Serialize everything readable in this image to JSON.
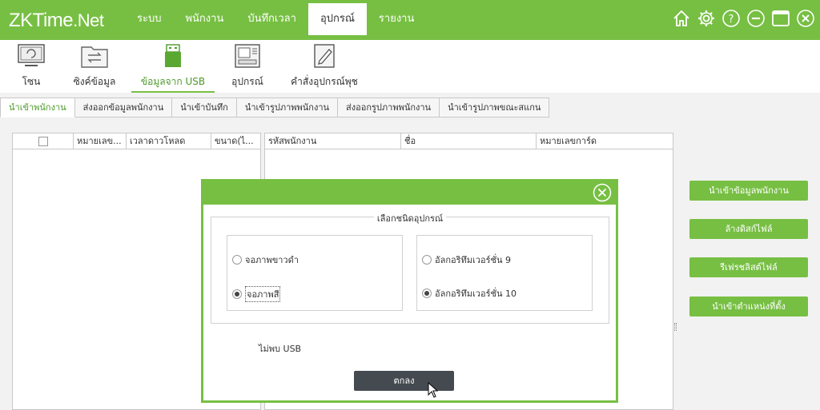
{
  "app": {
    "logo_main": "ZKTime",
    "logo_suffix": ".Net"
  },
  "menu": {
    "items": [
      {
        "label": "ระบบ"
      },
      {
        "label": "พนักงาน"
      },
      {
        "label": "บันทึกเวลา"
      },
      {
        "label": "อุปกรณ์",
        "active": true
      },
      {
        "label": "รายงาน"
      }
    ]
  },
  "window_icons": [
    "home-icon",
    "gear-icon",
    "help-icon",
    "minimize-icon",
    "maximize-icon",
    "close-icon"
  ],
  "toolbar": {
    "items": [
      {
        "label": "โซน",
        "icon": "zone-icon"
      },
      {
        "label": "ซิงค์ข้อมูล",
        "icon": "sync-folder-icon"
      },
      {
        "label": "ข้อมูลจาก USB",
        "icon": "usb-drive-icon",
        "active": true
      },
      {
        "label": "อุปกรณ์",
        "icon": "device-icon"
      },
      {
        "label": "คำสั่งอุปกรณ์พุช",
        "icon": "push-command-icon"
      }
    ]
  },
  "subtabs": [
    {
      "label": "นำเข้าพนักงาน",
      "active": true
    },
    {
      "label": "ส่งออกข้อมูลพนักงาน"
    },
    {
      "label": "นำเข้าบันทึก"
    },
    {
      "label": "นำเข้ารูปภาพพนักงาน"
    },
    {
      "label": "ส่งออกรูปภาพพนักงาน"
    },
    {
      "label": "นำเข้ารูปภาพขณะสแกน"
    }
  ],
  "left_table": {
    "columns": [
      "หมายเลข...",
      "เวลาดาวโหลด",
      "ขนาด(ไ..."
    ]
  },
  "mid_table": {
    "columns": [
      "รหัสพนักงาน",
      "ชื่อ",
      "หมายเลขการ์ด"
    ]
  },
  "side_buttons": [
    {
      "label": "นำเข้าข้อมูลพนักงาน"
    },
    {
      "label": "ล้างดิสก์ไฟล์"
    },
    {
      "label": "รีเฟรชลิสต์ไฟล์"
    },
    {
      "label": "นำเข้าตำแหน่งที่ตั้ง"
    }
  ],
  "dialog": {
    "group_title": "เลือกชนิดอุปกรณ์",
    "screen_options": [
      {
        "label": "จอภาพขาวดำ",
        "selected": false
      },
      {
        "label": "จอภาพสี",
        "selected": true
      }
    ],
    "algorithm_options": [
      {
        "label": "อัลกอริทึมเวอร์ชั่น 9",
        "selected": false
      },
      {
        "label": "อัลกอริทึมเวอร์ชั่น 10",
        "selected": true
      }
    ],
    "status_message": "ไม่พบ USB",
    "ok_label": "ตกลง"
  },
  "colors": {
    "brand_green": "#77bf43",
    "dark_button": "#444a50",
    "active_text": "#4c9a2a"
  }
}
